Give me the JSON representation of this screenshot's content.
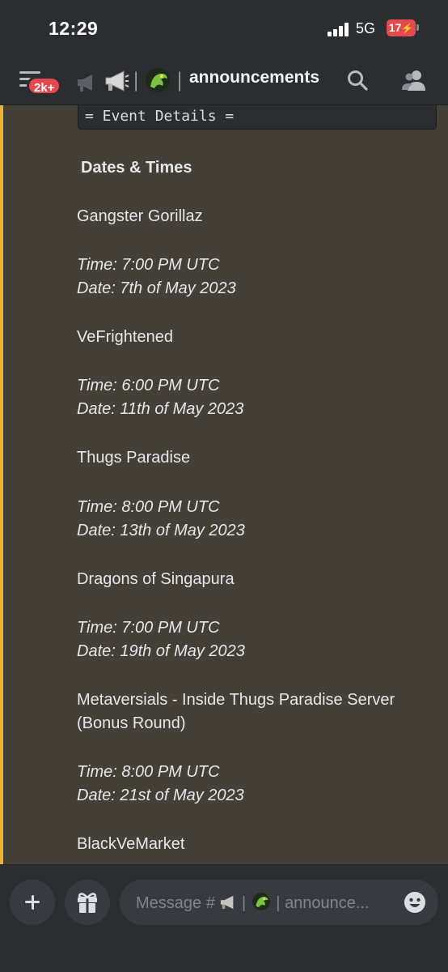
{
  "status_bar": {
    "time": "12:29",
    "network": "5G",
    "battery": "17"
  },
  "header": {
    "notification_badge": "2k+",
    "separator": "|",
    "channel_name": "announcements",
    "icons": [
      "menu-icon",
      "megaphone-icon",
      "dragon-emoji",
      "search-icon",
      "members-icon"
    ]
  },
  "message": {
    "code_text": "= Event Details =",
    "section_title": "Dates & Times",
    "events": [
      {
        "name": "Gangster Gorillaz",
        "time": "Time: 7:00 PM UTC",
        "date": "Date: 7th of May 2023"
      },
      {
        "name": "VeFrightened",
        "time": "Time: 6:00 PM UTC",
        "date": "Date: 11th of May 2023"
      },
      {
        "name": "Thugs Paradise",
        "time": "Time: 8:00 PM UTC",
        "date": "Date: 13th of May 2023"
      },
      {
        "name": "Dragons of Singapura",
        "time": "Time: 7:00 PM UTC",
        "date": "Date: 19th of May 2023"
      },
      {
        "name_line1": "Metaversials - Inside Thugs Paradise Server",
        "name_line2": "(Bonus Round)",
        "time": "Time: 8:00 PM UTC",
        "date": "Date: 21st of May 2023"
      },
      {
        "name": "BlackVeMarket"
      }
    ]
  },
  "composer": {
    "placeholder_prefix": "Message #",
    "placeholder_suffix": "announce...",
    "icons": [
      "plus-icon",
      "gift-icon",
      "emoji-icon"
    ]
  },
  "colors": {
    "background": "#313338",
    "header": "#2b2d31",
    "highlight": "#444037",
    "highlight_bar": "#f0b232",
    "badge": "#e5484d"
  }
}
